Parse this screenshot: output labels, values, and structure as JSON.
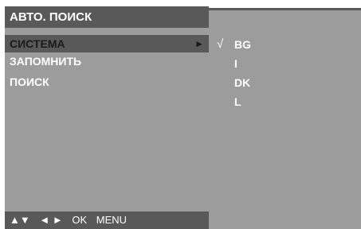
{
  "menu": {
    "title": "АВТО. ПОИСК",
    "items": [
      {
        "label": "СИСТЕМА",
        "selected": true,
        "arrow": "►"
      },
      {
        "label": "ЗАПОМНИТЬ",
        "selected": false
      },
      {
        "label": "ПОИСК",
        "selected": false
      }
    ]
  },
  "footer": {
    "updown": "▲▼",
    "leftright": "◄ ►",
    "ok": "OK",
    "menu": "MENU"
  },
  "submenu": {
    "check_mark": "√",
    "options": [
      {
        "label": "BG",
        "checked": true
      },
      {
        "label": "I",
        "checked": false
      },
      {
        "label": "DK",
        "checked": false
      },
      {
        "label": "L",
        "checked": false
      }
    ]
  },
  "colors": {
    "panel": "#9c9c9c",
    "bar": "#595959",
    "text": "#ffffff"
  }
}
